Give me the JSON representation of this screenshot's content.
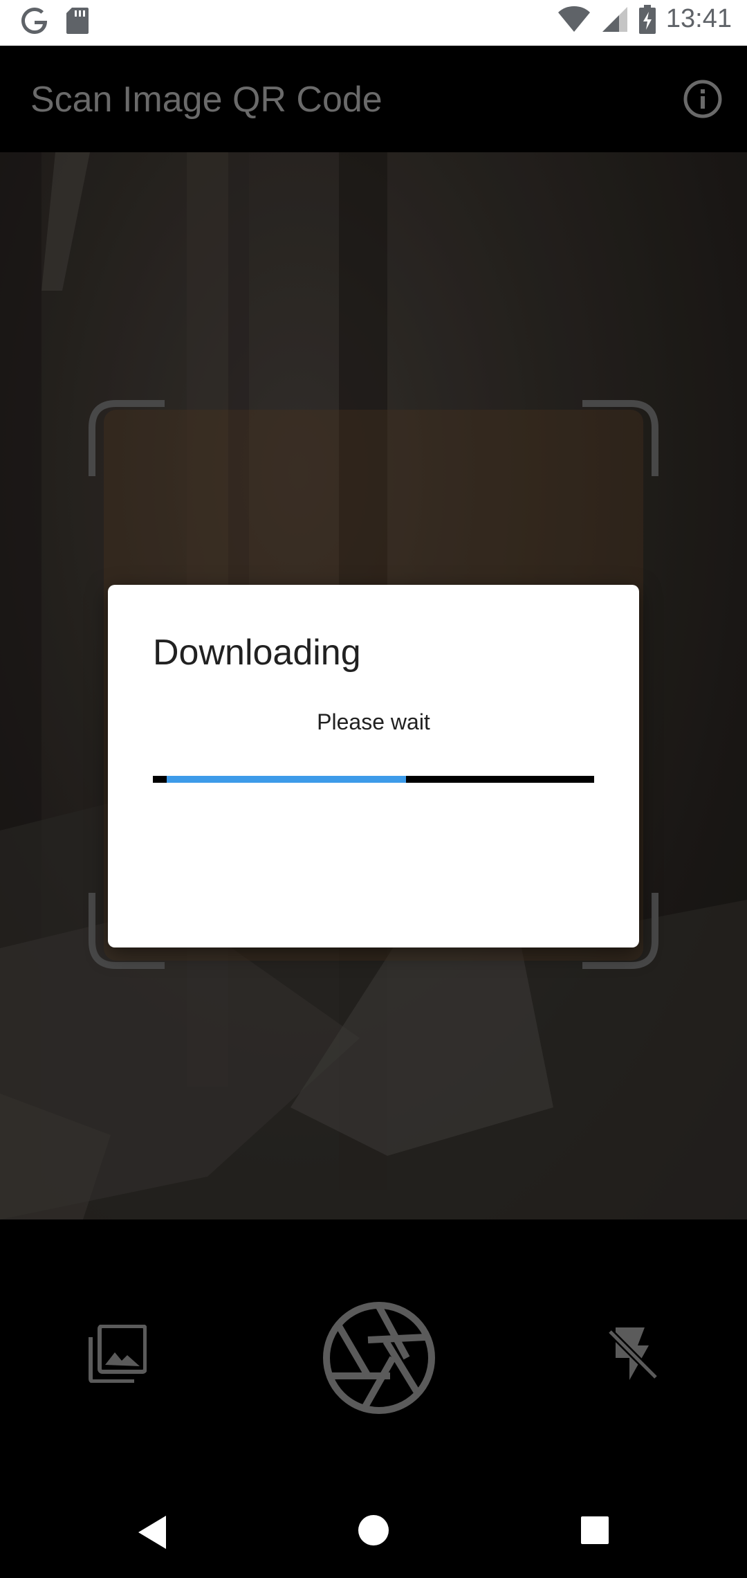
{
  "status_bar": {
    "time": "13:41",
    "icons": [
      "google-icon",
      "sd-card-icon",
      "wifi-icon",
      "cell-signal-icon",
      "battery-charging-icon"
    ]
  },
  "app_bar": {
    "title": "Scan Image QR Code",
    "info_icon": "info-icon"
  },
  "dialog": {
    "title": "Downloading",
    "message": "Please wait",
    "progress": 0.56,
    "progress_color": "#3d9be9"
  },
  "controls": {
    "gallery_icon": "gallery-icon",
    "shutter_icon": "shutter-icon",
    "flash_icon": "flash-off-icon"
  },
  "nav_bar": {
    "icons": [
      "back-icon",
      "home-icon",
      "recents-icon"
    ]
  }
}
